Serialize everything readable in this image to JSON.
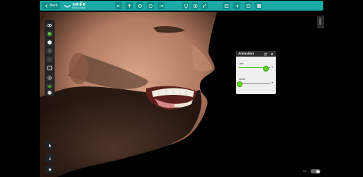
{
  "topbar": {
    "back_label": "Back",
    "logo_main": "smile",
    "logo_sub": "DESIGNER",
    "accent": "#1aa9a4",
    "buttons": [
      "arrow-left-icon",
      "arrow-up-icon",
      "target-icon",
      "face-icon",
      "arrow-right-icon",
      "tooth-icon",
      "tooth-group-icon",
      "brush-icon",
      "export-icon",
      "add-icon",
      "image-icon",
      "grid-icon"
    ]
  },
  "right_tab": {
    "label": "Save"
  },
  "animation_panel": {
    "title": "Animation",
    "sliders": [
      {
        "label": "Jaw",
        "value": 0.85
      },
      {
        "label": "Smile",
        "value": 0.0
      }
    ]
  },
  "left_toolbar": {
    "buttons": [
      "eye-icon",
      "sphere-icon",
      "circle-white-icon",
      "circle-dark-icon",
      "square-rounded-icon",
      "square-outline-icon",
      "gear-icon",
      "lips-icon",
      "teeth-icon"
    ],
    "bottom_buttons": [
      "cursor-icon",
      "arrow-down-icon",
      "star-icon"
    ]
  },
  "bottom_right": {
    "label": "Off"
  }
}
